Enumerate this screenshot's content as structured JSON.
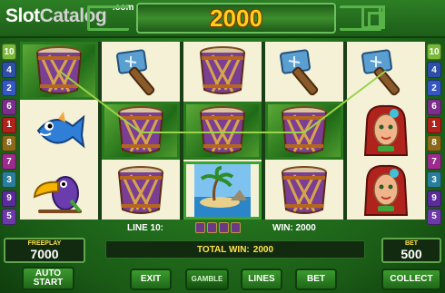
{
  "brand": {
    "logo_slot": "Slot",
    "logo_catalog": "Catalog",
    "logo_com": ".com"
  },
  "display": {
    "win_amount": "2000"
  },
  "line_markers": {
    "left": [
      {
        "label": "10",
        "color": "#7ab83a"
      },
      {
        "label": "4",
        "color": "#2e4fa8"
      },
      {
        "label": "2",
        "color": "#3457c2"
      },
      {
        "label": "6",
        "color": "#7a2f8c"
      },
      {
        "label": "1",
        "color": "#b0221c"
      },
      {
        "label": "8",
        "color": "#8a6a1a"
      },
      {
        "label": "7",
        "color": "#9b2b8c"
      },
      {
        "label": "3",
        "color": "#2b7e9b"
      },
      {
        "label": "9",
        "color": "#5b2b9b"
      },
      {
        "label": "5",
        "color": "#6b3aa8"
      }
    ],
    "right": [
      {
        "label": "10",
        "color": "#7ab83a"
      },
      {
        "label": "4",
        "color": "#2e4fa8"
      },
      {
        "label": "2",
        "color": "#3457c2"
      },
      {
        "label": "6",
        "color": "#7a2f8c"
      },
      {
        "label": "1",
        "color": "#b0221c"
      },
      {
        "label": "8",
        "color": "#8a6a1a"
      },
      {
        "label": "7",
        "color": "#9b2b8c"
      },
      {
        "label": "3",
        "color": "#2b7e9b"
      },
      {
        "label": "9",
        "color": "#5b2b9b"
      },
      {
        "label": "5",
        "color": "#6b3aa8"
      }
    ]
  },
  "reels": [
    [
      "drum",
      "fish",
      "toucan"
    ],
    [
      "hammer",
      "drum",
      "drum"
    ],
    [
      "drum",
      "drum",
      "island"
    ],
    [
      "hammer",
      "drum",
      "drum"
    ],
    [
      "hammer",
      "woman",
      "woman"
    ]
  ],
  "winning_cells": [
    [
      0,
      0
    ],
    [
      1,
      1
    ],
    [
      2,
      1
    ],
    [
      3,
      1
    ]
  ],
  "selected_cells": [
    [
      2,
      2
    ]
  ],
  "info": {
    "line_label": "LINE 10:",
    "win_label": "WIN: 2000"
  },
  "panels": {
    "freeplay_title": "FREEPLAY",
    "freeplay_value": "7000",
    "bet_title": "BET",
    "bet_value": "500",
    "total_win_label": "TOTAL WIN:",
    "total_win_value": "2000"
  },
  "buttons": {
    "autostart": "AUTO START",
    "exit": "EXIT",
    "gamble": "GAMBLE",
    "lines": "LINES",
    "bet": "BET",
    "collect": "COLLECT"
  }
}
